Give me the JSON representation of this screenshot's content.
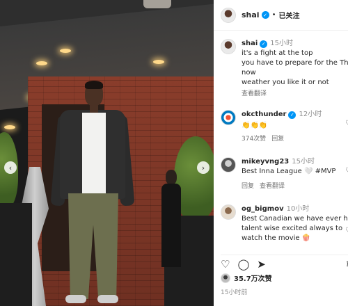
{
  "header": {
    "username": "shai",
    "separator": "•",
    "follow_status": "已关注"
  },
  "caption": {
    "username": "shai",
    "time": "15小时",
    "lines": [
      "it's a fight at the top",
      "you have to prepare for the Thunder",
      "now",
      "weather you like it or not"
    ],
    "translate": "查看翻译"
  },
  "comments": [
    {
      "username": "okcthunder",
      "time": "12小时",
      "text": "👏👏👏",
      "likes": "374次赞",
      "reply": "回复"
    },
    {
      "username": "mikeyvng23",
      "time": "15小时",
      "text": "Best Inna League 🤍 #MVP",
      "reply": "回复",
      "translate": "查看翻译"
    },
    {
      "username": "og_bigmov",
      "time": "10小时",
      "lines": [
        "Best Canadian we have ever had",
        "talent wise excited always to",
        "watch the movie 🍿"
      ]
    }
  ],
  "footer": {
    "likes": "35.7万次赞",
    "time": "15小时前"
  },
  "icons": {
    "like": "heart-icon",
    "comment": "comment-icon",
    "share": "send-icon",
    "save": "bookmark-icon",
    "carousel_prev": "chevron-left-icon",
    "carousel_next": "chevron-right-icon"
  }
}
